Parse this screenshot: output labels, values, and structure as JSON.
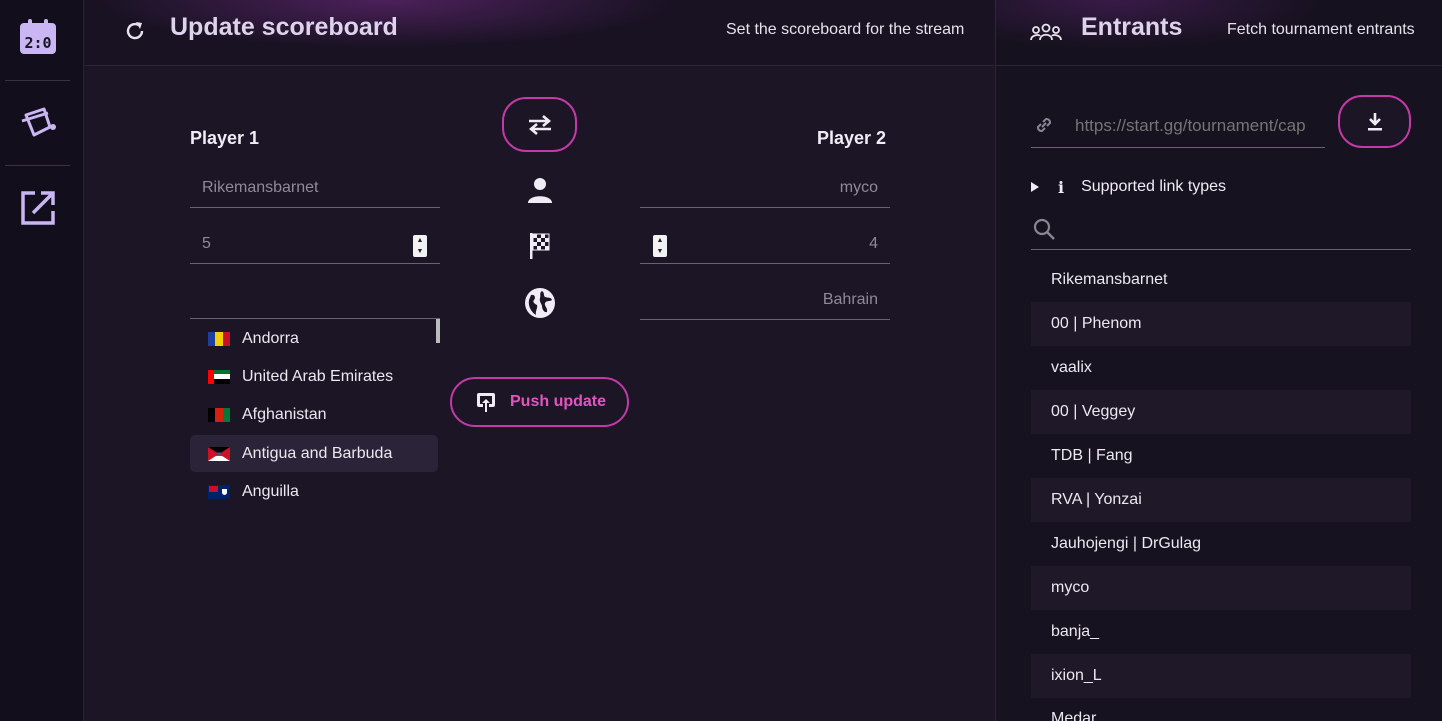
{
  "nav": {
    "items": [
      {
        "name": "scoreboard",
        "icon": "scoreboard-icon"
      },
      {
        "name": "theme",
        "icon": "paint-bucket-icon"
      },
      {
        "name": "open-external",
        "icon": "open-external-icon"
      }
    ]
  },
  "scoreboard": {
    "title": "Update scoreboard",
    "subtitle": "Set the scoreboard for the stream",
    "player1": {
      "label": "Player 1",
      "name": "Rikemansbarnet",
      "score": "5",
      "country": ""
    },
    "player2": {
      "label": "Player 2",
      "name": "myco",
      "score": "4",
      "country": "Bahrain"
    },
    "push_label": "Push update",
    "country_options": [
      {
        "name": "Andorra",
        "selected": false
      },
      {
        "name": "United Arab Emirates",
        "selected": false
      },
      {
        "name": "Afghanistan",
        "selected": false
      },
      {
        "name": "Antigua and Barbuda",
        "selected": true
      },
      {
        "name": "Anguilla",
        "selected": false
      }
    ]
  },
  "entrants": {
    "title": "Entrants",
    "subtitle": "Fetch tournament entrants",
    "url_placeholder": "https://start.gg/tournament/cap",
    "supported_label": "Supported link types",
    "list": [
      "Rikemansbarnet",
      "00 | Phenom",
      "vaalix",
      "00 | Veggey",
      "TDB | Fang",
      "RVA | Yonzai",
      "Jauhojengi | DrGulag",
      "myco",
      "banja_",
      "ixion_L",
      "Medar"
    ]
  },
  "colors": {
    "accent": "#c23aa6",
    "push_text": "#e255c0",
    "nav_icon": "#c9b6f2"
  }
}
